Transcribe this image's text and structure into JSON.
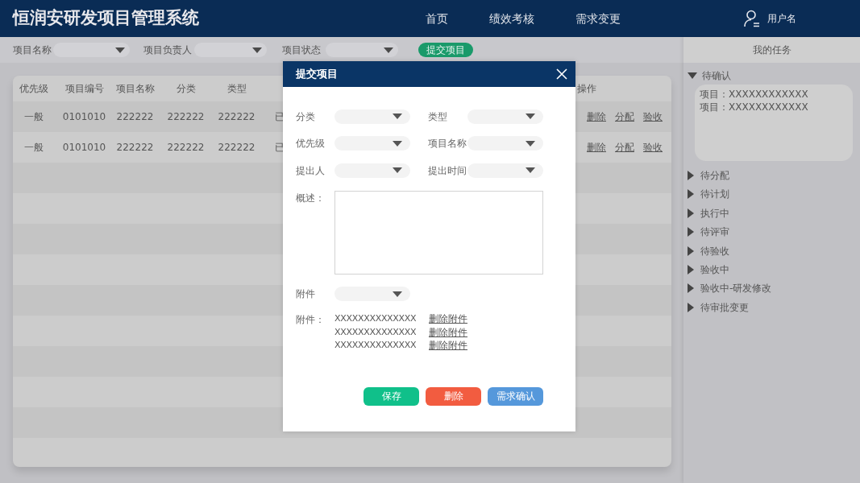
{
  "app_title": "恒润安研发项目管理系统",
  "nav": [
    {
      "label": "首页"
    },
    {
      "label": "绩效考核"
    },
    {
      "label": "需求变更"
    }
  ],
  "user": {
    "name": "用户名"
  },
  "filters": [
    {
      "label": "项目名称"
    },
    {
      "label": "项目负责人"
    },
    {
      "label": "项目状态"
    }
  ],
  "submit_button": "提交项目",
  "table": {
    "columns": [
      "优先级",
      "项目编号",
      "项目名称",
      "分类",
      "类型"
    ],
    "action_column": "操作",
    "rows": [
      {
        "cells": [
          "一般",
          "0101010",
          "222222",
          "222222",
          "222222",
          "已"
        ],
        "actions": [
          "删除",
          "分配",
          "验收"
        ]
      },
      {
        "cells": [
          "一般",
          "0101010",
          "222222",
          "222222",
          "222222",
          "已"
        ],
        "actions": [
          "删除",
          "分配",
          "验收"
        ]
      }
    ]
  },
  "tasks": {
    "title": "我的任务",
    "groups": [
      {
        "label": "待确认",
        "expanded": true,
        "children": [
          {
            "label": "项目：XXXXXXXXXXXX"
          },
          {
            "label": "项目：XXXXXXXXXXXX"
          }
        ]
      },
      {
        "label": "待分配",
        "expanded": false
      },
      {
        "label": "待计划",
        "expanded": false
      },
      {
        "label": "执行中",
        "expanded": false
      },
      {
        "label": "待评审",
        "expanded": false
      },
      {
        "label": "待验收",
        "expanded": false
      },
      {
        "label": "验收中",
        "expanded": false
      },
      {
        "label": "验收中-研发修改",
        "expanded": false
      },
      {
        "label": "待审批变更",
        "expanded": false
      }
    ]
  },
  "dialog": {
    "title": "提交项目",
    "fields": [
      {
        "label": "分类"
      },
      {
        "label": "类型"
      },
      {
        "label": "优先级"
      },
      {
        "label": "项目名称"
      },
      {
        "label": "提出人"
      },
      {
        "label": "提出时间"
      }
    ],
    "description_label": "概述：",
    "attachment_select_label": "附件",
    "attachments_label": "附件：",
    "attachments": [
      {
        "name": "XXXXXXXXXXXXXX",
        "remove": "删除附件"
      },
      {
        "name": "XXXXXXXXXXXXXX",
        "remove": "删除附件"
      },
      {
        "name": "XXXXXXXXXXXXXX",
        "remove": "删除附件"
      }
    ],
    "buttons": [
      {
        "label": "保存",
        "color": "#10c08a"
      },
      {
        "label": "删除",
        "color": "#f25c40"
      },
      {
        "label": "需求确认",
        "color": "#5598db"
      }
    ]
  }
}
